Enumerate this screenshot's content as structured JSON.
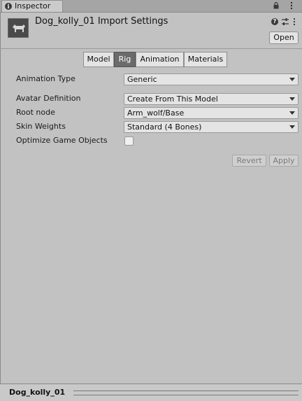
{
  "window": {
    "tab_title": "Inspector",
    "tab_icon": "info-icon"
  },
  "header": {
    "title": "Dog_kolly_01 Import Settings",
    "open_label": "Open",
    "icons": [
      "help-icon",
      "settings-icon",
      "kebab-icon",
      "lock-icon",
      "menu-dots-icon"
    ]
  },
  "tabs": [
    {
      "label": "Model",
      "active": false
    },
    {
      "label": "Rig",
      "active": true
    },
    {
      "label": "Animation",
      "active": false
    },
    {
      "label": "Materials",
      "active": false
    }
  ],
  "fields": {
    "animation_type": {
      "label": "Animation Type",
      "value": "Generic"
    },
    "avatar_definition": {
      "label": "Avatar Definition",
      "value": "Create From This Model"
    },
    "root_node": {
      "label": "Root node",
      "value": "Arm_wolf/Base"
    },
    "skin_weights": {
      "label": "Skin Weights",
      "value": "Standard (4 Bones)"
    },
    "optimize_game_objects": {
      "label": "Optimize Game Objects",
      "checked": false
    }
  },
  "actions": {
    "revert_label": "Revert",
    "apply_label": "Apply"
  },
  "preview": {
    "title": "Dog_kolly_01"
  }
}
